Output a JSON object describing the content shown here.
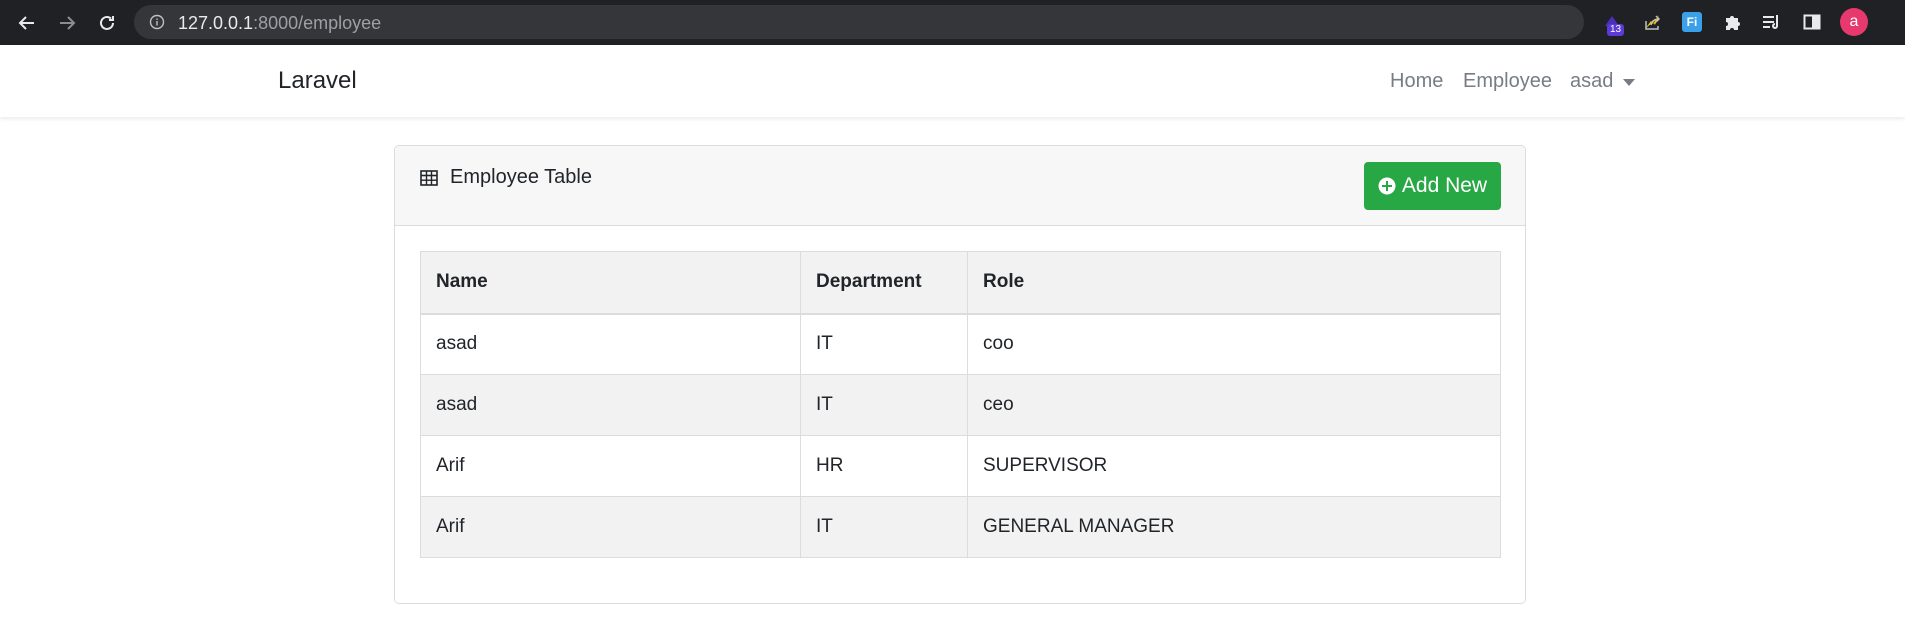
{
  "browser": {
    "url_host": "127.0.0.1",
    "url_path": ":8000/employee",
    "extension_badge": "13",
    "ext_fi_label": "Fi",
    "avatar_letter": "a"
  },
  "navbar": {
    "brand": "Laravel",
    "links": [
      {
        "label": "Home"
      },
      {
        "label": "Employee"
      }
    ],
    "user": "asad"
  },
  "card": {
    "title": "Employee Table",
    "add_button": "Add New"
  },
  "table": {
    "headers": [
      "Name",
      "Department",
      "Role"
    ],
    "rows": [
      [
        "asad",
        "IT",
        "coo"
      ],
      [
        "asad",
        "IT",
        "ceo"
      ],
      [
        "Arif",
        "HR",
        "SUPERVISOR"
      ],
      [
        "Arif",
        "IT",
        "GENERAL MANAGER"
      ]
    ]
  },
  "colors": {
    "chrome_bg": "#202124",
    "success": "#28a745",
    "avatar": "#e8396f"
  }
}
